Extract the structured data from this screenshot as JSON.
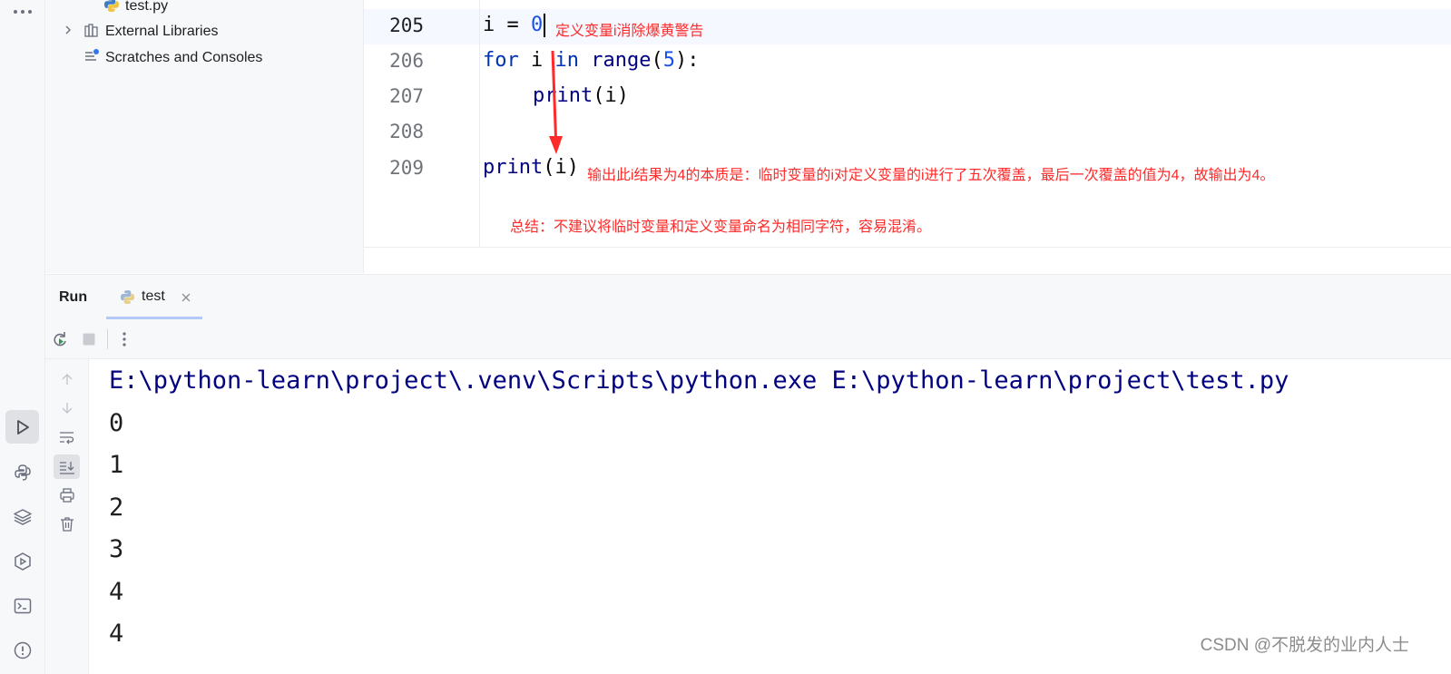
{
  "tree": {
    "file_label": "test.py",
    "external_libraries": "External Libraries",
    "scratches": "Scratches and Consoles"
  },
  "editor": {
    "line_numbers": [
      "205",
      "206",
      "207",
      "208",
      "209"
    ],
    "line_205": {
      "var": "i",
      "eq": " = ",
      "num": "0"
    },
    "line_206": {
      "kw_for": "for",
      "var": " i ",
      "kw_in": "in",
      "fn": " range",
      "open": "(",
      "num": "5",
      "close": "):"
    },
    "line_207": {
      "fn": "print",
      "args": "(i)"
    },
    "line_209": {
      "fn": "print",
      "args": "(i)"
    },
    "annotations": {
      "note1": "定义变量i消除爆黄警告",
      "note2": "输出此i结果为4的本质是：临时变量的i对定义变量的i进行了五次覆盖，最后一次覆盖的值为4，故输出为4。",
      "note3": "总结：不建议将临时变量和定义变量命名为相同字符，容易混淆。"
    }
  },
  "run_panel": {
    "title": "Run",
    "tab_label": "test",
    "command": "E:\\python-learn\\project\\.venv\\Scripts\\python.exe E:\\python-learn\\project\\test.py",
    "output": [
      "0",
      "1",
      "2",
      "3",
      "4",
      "4"
    ]
  },
  "watermark": "CSDN @不脱发的业内人士",
  "colors": {
    "keyword": "#0033b3",
    "number": "#1750eb",
    "function": "#000080",
    "annotation": "#ff2a2a",
    "current_line": "#f5f8fe"
  }
}
